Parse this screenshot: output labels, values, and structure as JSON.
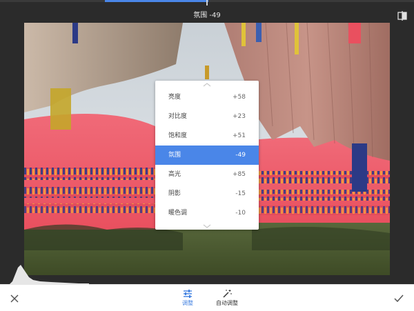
{
  "status": {
    "label": "氛围 -49",
    "progress_fraction": 0.25
  },
  "toolbar": {
    "compare_icon": "compare-split-icon"
  },
  "menu": {
    "items": [
      {
        "name": "亮度",
        "value": "+58"
      },
      {
        "name": "对比度",
        "value": "+23"
      },
      {
        "name": "饱和度",
        "value": "+51"
      },
      {
        "name": "氛围",
        "value": "-49",
        "selected": true
      },
      {
        "name": "高光",
        "value": "+85"
      },
      {
        "name": "阴影",
        "value": "-15"
      },
      {
        "name": "暖色调",
        "value": "-10"
      }
    ]
  },
  "bottombar": {
    "cancel_icon": "close-icon",
    "apply_icon": "checkmark-icon",
    "tools": [
      {
        "label": "调整",
        "icon": "sliders-icon",
        "active": true
      },
      {
        "label": "自动调整",
        "icon": "magic-wand-icon",
        "active": false
      }
    ]
  },
  "colors": {
    "accent": "#4a86e8",
    "background": "#2b2b2b"
  }
}
